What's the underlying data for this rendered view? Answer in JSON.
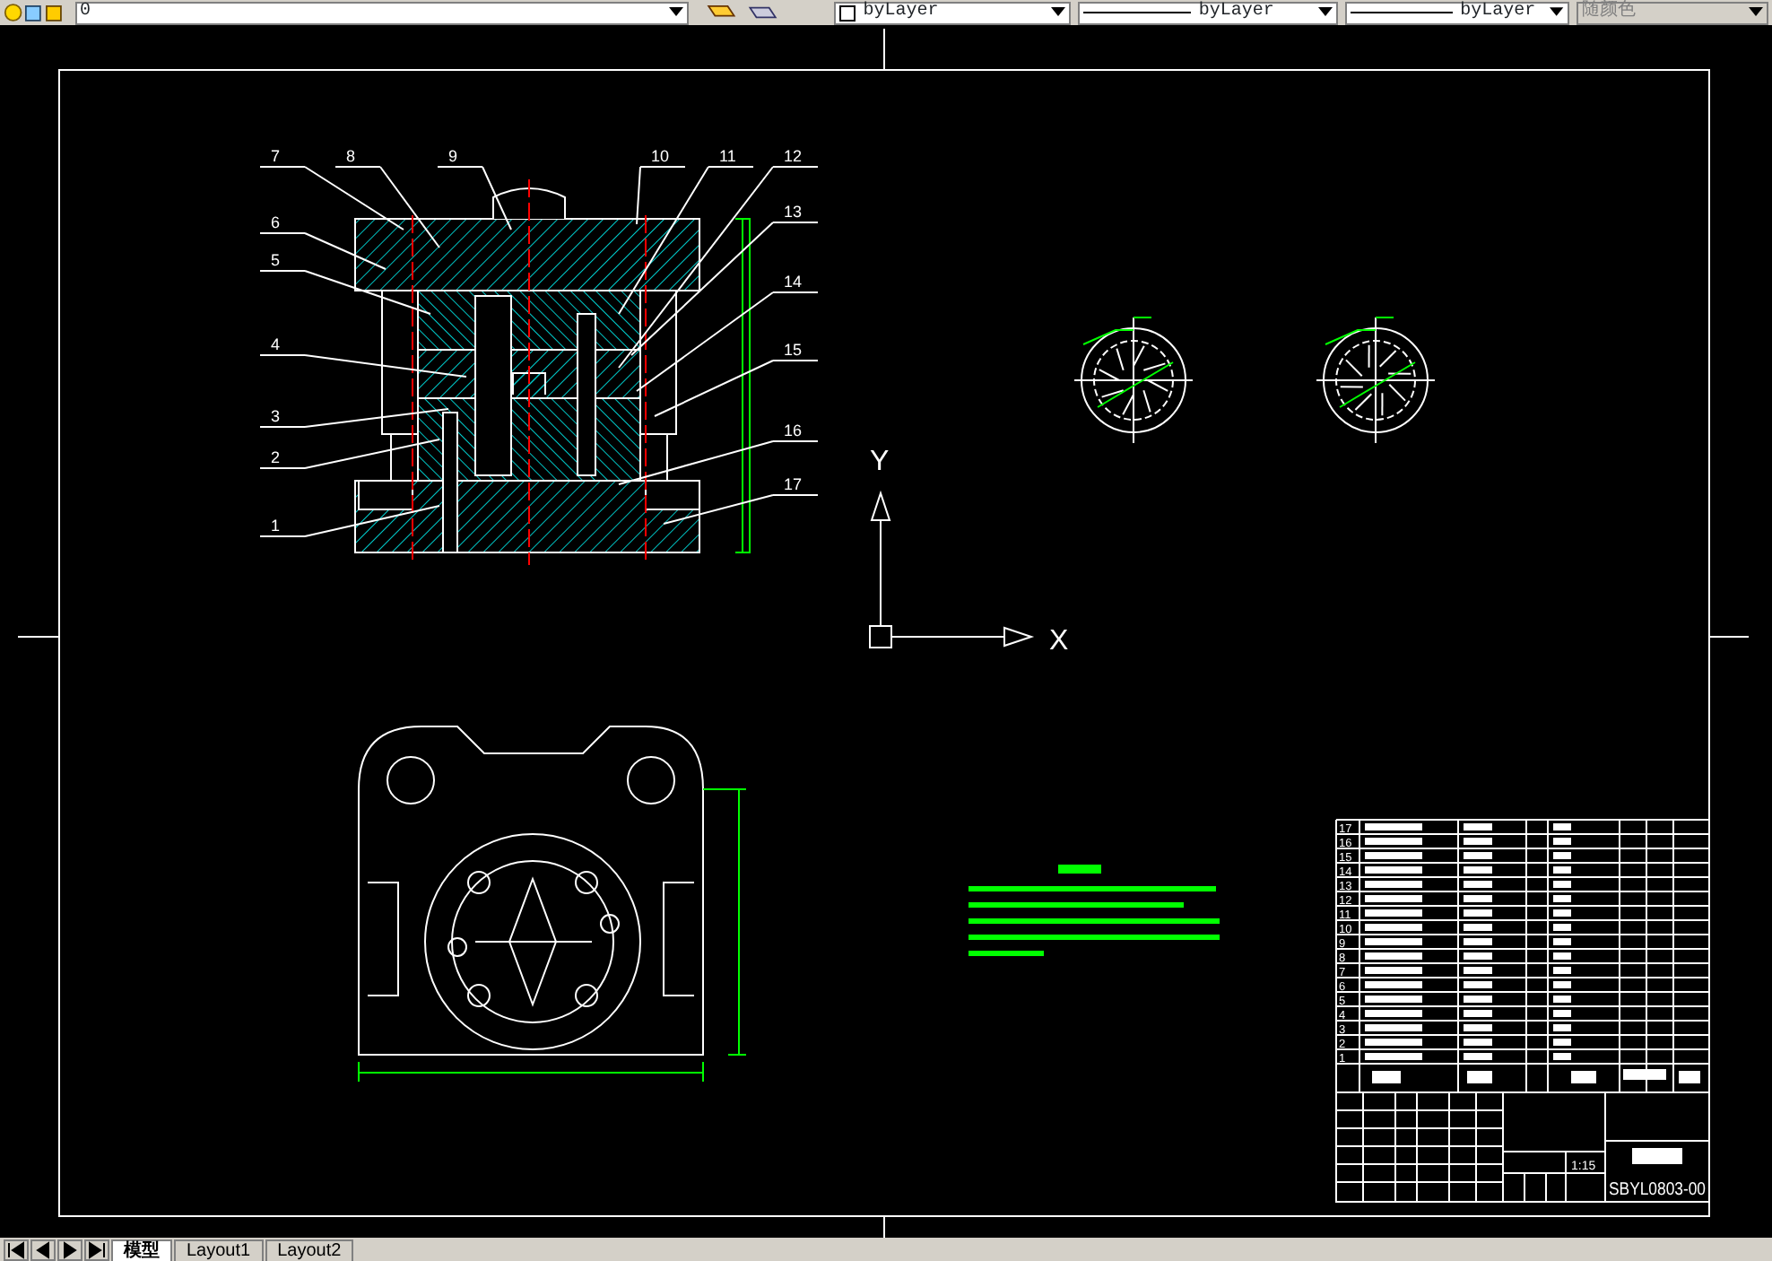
{
  "toolbar": {
    "layer": "0",
    "color_control": "byLayer",
    "linetype": "byLayer",
    "lineweight": "byLayer",
    "plot_style": {
      "value": "随颜色",
      "disabled": true
    }
  },
  "drawing": {
    "balloons": [
      {
        "label": "7"
      },
      {
        "label": "8"
      },
      {
        "label": "9"
      },
      {
        "label": "10"
      },
      {
        "label": "11"
      },
      {
        "label": "12"
      },
      {
        "label": "13"
      },
      {
        "label": "6"
      },
      {
        "label": "5"
      },
      {
        "label": "14"
      },
      {
        "label": "4"
      },
      {
        "label": "15"
      },
      {
        "label": "3"
      },
      {
        "label": "16"
      },
      {
        "label": "2"
      },
      {
        "label": "17"
      },
      {
        "label": "1"
      }
    ],
    "axes": {
      "y": "Y",
      "x": "X"
    },
    "parts_list": {
      "item_numbers": [
        "17",
        "16",
        "15",
        "14",
        "13",
        "12",
        "11",
        "10",
        "9",
        "8",
        "7",
        "6",
        "5",
        "4",
        "3",
        "2",
        "1"
      ]
    },
    "title_block": {
      "scale": "1:15",
      "drawing_number": "SBYL0803-00"
    }
  },
  "tabs": [
    {
      "label": "模型",
      "selected": true
    },
    {
      "label": "Layout1",
      "selected": false
    },
    {
      "label": "Layout2",
      "selected": false
    }
  ]
}
